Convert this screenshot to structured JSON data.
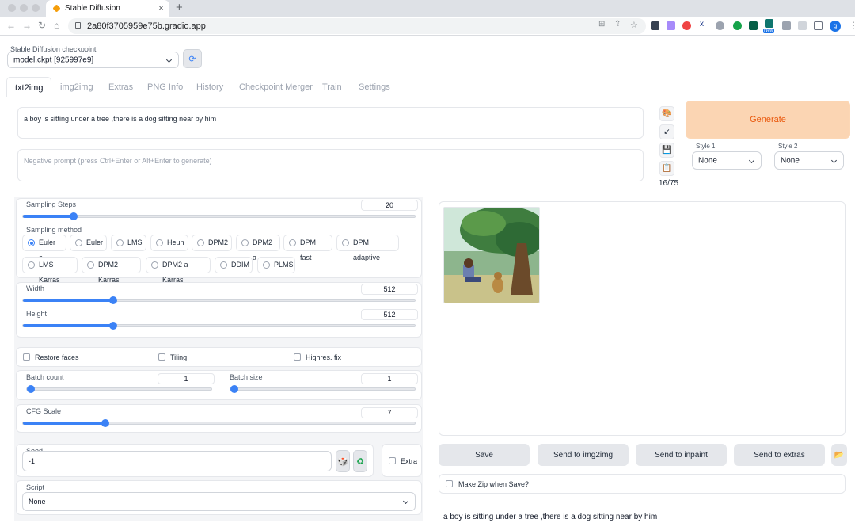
{
  "browser": {
    "tab_title": "Stable Diffusion",
    "url": "2a80f3705959e75b.gradio.app",
    "profile_initial": "g",
    "ext_new_badge": "New"
  },
  "checkpoint": {
    "label": "Stable Diffusion checkpoint",
    "value": "model.ckpt [925997e9]"
  },
  "tabs": [
    {
      "label": "txt2img"
    },
    {
      "label": "img2img"
    },
    {
      "label": "Extras"
    },
    {
      "label": "PNG Info"
    },
    {
      "label": "History"
    },
    {
      "label": "Checkpoint Merger"
    },
    {
      "label": "Train"
    },
    {
      "label": "Settings"
    }
  ],
  "prompt": {
    "value": "a boy is sitting under a tree ,there is a dog sitting near by him",
    "negative_placeholder": "Negative prompt (press Ctrl+Enter or Alt+Enter to generate)",
    "token_count": "16/75"
  },
  "generate_label": "Generate",
  "style1": {
    "label": "Style 1",
    "value": "None"
  },
  "style2": {
    "label": "Style 2",
    "value": "None"
  },
  "sampling_steps": {
    "label": "Sampling Steps",
    "value": "20",
    "fraction": 0.13
  },
  "sampling_method": {
    "label": "Sampling method",
    "options": [
      "Euler a",
      "Euler",
      "LMS",
      "Heun",
      "DPM2",
      "DPM2 a",
      "DPM fast",
      "DPM adaptive",
      "LMS Karras",
      "DPM2 Karras",
      "DPM2 a Karras",
      "DDIM",
      "PLMS"
    ],
    "selected": "Euler a"
  },
  "width": {
    "label": "Width",
    "value": "512",
    "fraction": 0.23
  },
  "height": {
    "label": "Height",
    "value": "512",
    "fraction": 0.23
  },
  "checks": {
    "restore_faces": "Restore faces",
    "tiling": "Tiling",
    "highres": "Highres. fix"
  },
  "batch_count": {
    "label": "Batch count",
    "value": "1",
    "fraction": 0.0
  },
  "batch_size": {
    "label": "Batch size",
    "value": "1",
    "fraction": 0.0
  },
  "cfg_scale": {
    "label": "CFG Scale",
    "value": "7",
    "fraction": 0.21
  },
  "seed": {
    "label": "Seed",
    "value": "-1",
    "extra_label": "Extra"
  },
  "script": {
    "label": "Script",
    "value": "None"
  },
  "output": {
    "save": "Save",
    "send_img2img": "Send to img2img",
    "send_inpaint": "Send to inpaint",
    "send_extras": "Send to extras",
    "make_zip": "Make Zip when Save?",
    "info_text": "a boy is sitting under a tree ,there is a dog sitting near by him"
  },
  "colors": {
    "accent": "#3b82f6",
    "generate_bg": "#fbd5b3",
    "generate_text": "#ea580c"
  }
}
